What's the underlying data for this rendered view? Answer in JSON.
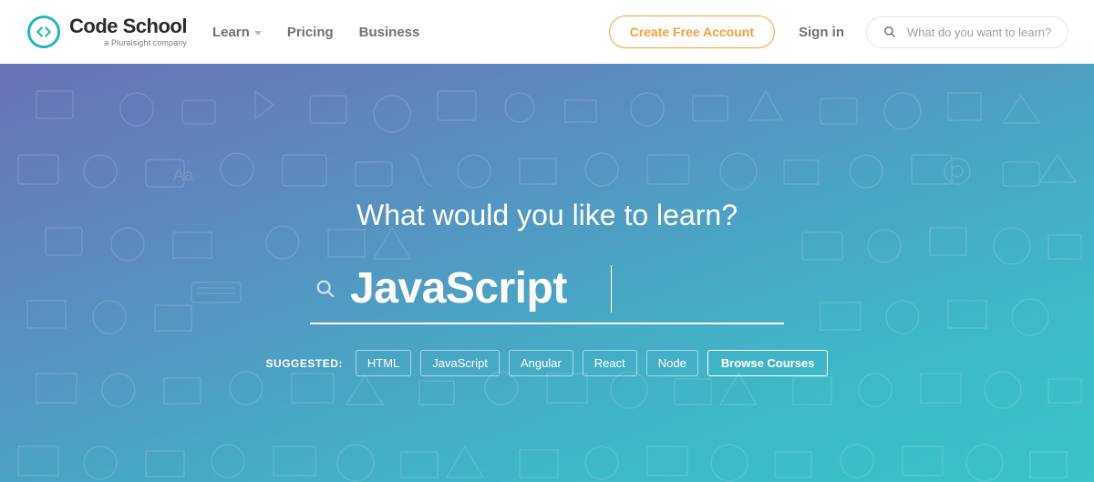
{
  "header": {
    "logo": {
      "main": "Code School",
      "sub": "a Pluralsight company"
    },
    "nav": [
      "Learn",
      "Pricing",
      "Business"
    ],
    "create_button": "Create Free Account",
    "signin": "Sign in",
    "search_placeholder": "What do you want to learn?"
  },
  "hero": {
    "title": "What would you like to learn?",
    "search_value": "JavaScript",
    "suggested_label": "SUGGESTED:",
    "tags": [
      "HTML",
      "JavaScript",
      "Angular",
      "React",
      "Node"
    ],
    "browse": "Browse Courses"
  }
}
